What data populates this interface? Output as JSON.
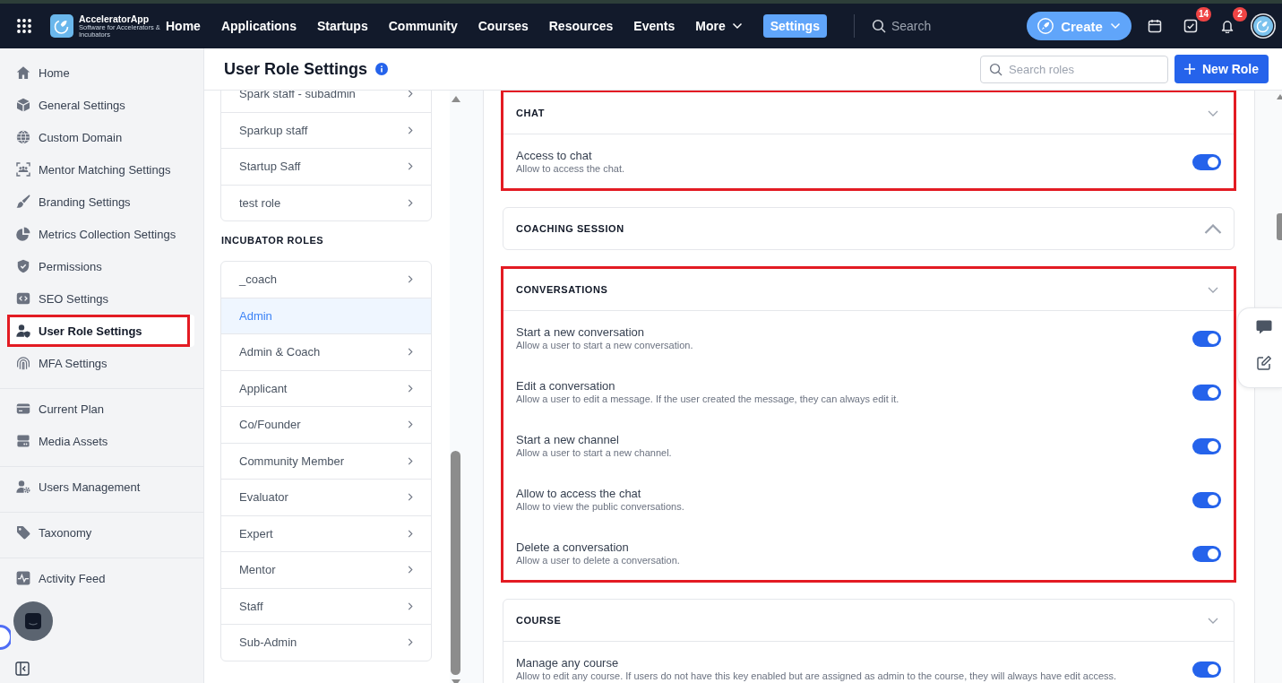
{
  "topbar": {
    "brand": "AcceleratorApp",
    "tagline": "Software for Accelerators & Incubators",
    "nav": [
      {
        "label": "Home",
        "kind": "link",
        "selected": false
      },
      {
        "label": "Applications",
        "kind": "link",
        "selected": false
      },
      {
        "label": "Startups",
        "kind": "link",
        "selected": false
      },
      {
        "label": "Community",
        "kind": "link",
        "selected": false
      },
      {
        "label": "Courses",
        "kind": "link",
        "selected": false
      },
      {
        "label": "Resources",
        "kind": "link",
        "selected": false
      },
      {
        "label": "Events",
        "kind": "link",
        "selected": false
      },
      {
        "label": "More",
        "kind": "menu",
        "selected": false
      },
      {
        "label": "Settings",
        "kind": "link",
        "selected": true
      }
    ],
    "search": {
      "placeholder": "Search"
    },
    "create_button": {
      "label": "Create"
    },
    "tasks_badge": "14",
    "notifications_badge": "2"
  },
  "sidebar": {
    "groups": [
      {
        "items": [
          {
            "label": "Home",
            "selected": false,
            "highlighted": false
          },
          {
            "label": "General Settings",
            "selected": false,
            "highlighted": false
          },
          {
            "label": "Custom Domain",
            "selected": false,
            "highlighted": false
          },
          {
            "label": "Mentor Matching Settings",
            "selected": false,
            "highlighted": false
          },
          {
            "label": "Branding Settings",
            "selected": false,
            "highlighted": false
          },
          {
            "label": "Metrics Collection Settings",
            "selected": false,
            "highlighted": false
          },
          {
            "label": "Permissions",
            "selected": false,
            "highlighted": false
          },
          {
            "label": "SEO Settings",
            "selected": false,
            "highlighted": false
          },
          {
            "label": "User Role Settings",
            "selected": true,
            "highlighted": true
          },
          {
            "label": "MFA Settings",
            "selected": false,
            "highlighted": false
          }
        ]
      },
      {
        "items": [
          {
            "label": "Current Plan",
            "selected": false,
            "highlighted": false
          },
          {
            "label": "Media Assets",
            "selected": false,
            "highlighted": false
          }
        ]
      },
      {
        "items": [
          {
            "label": "Users Management",
            "selected": false,
            "highlighted": false
          }
        ]
      },
      {
        "items": [
          {
            "label": "Taxonomy",
            "selected": false,
            "highlighted": false
          }
        ]
      },
      {
        "items": [
          {
            "label": "Activity Feed",
            "selected": false,
            "highlighted": false
          }
        ]
      }
    ]
  },
  "page": {
    "title": "User Role Settings",
    "search": {
      "placeholder": "Search roles"
    },
    "new_button": "New Role"
  },
  "role_groups": [
    {
      "roles": [
        {
          "label": "Spark staff - subadmin",
          "selected": false
        },
        {
          "label": "Sparkup staff",
          "selected": false
        },
        {
          "label": "Startup Saff",
          "selected": false
        },
        {
          "label": "test role",
          "selected": false
        }
      ]
    },
    {
      "heading": "INCUBATOR ROLES",
      "roles": [
        {
          "label": "_coach",
          "selected": false
        },
        {
          "label": "Admin",
          "selected": true
        },
        {
          "label": "Admin & Coach",
          "selected": false
        },
        {
          "label": "Applicant",
          "selected": false
        },
        {
          "label": "Co/Founder",
          "selected": false
        },
        {
          "label": "Community Member",
          "selected": false
        },
        {
          "label": "Evaluator",
          "selected": false
        },
        {
          "label": "Expert",
          "selected": false
        },
        {
          "label": "Mentor",
          "selected": false
        },
        {
          "label": "Staff",
          "selected": false
        },
        {
          "label": "Sub-Admin",
          "selected": false
        }
      ]
    }
  ],
  "sections": [
    {
      "title": "CHAT",
      "expanded": true,
      "highlighted": true,
      "permissions": [
        {
          "title": "Access to chat",
          "description": "Allow to access the chat.",
          "on": true
        }
      ]
    },
    {
      "title": "COACHING SESSION",
      "expanded": false,
      "highlighted": false
    },
    {
      "title": "CONVERSATIONS",
      "expanded": true,
      "highlighted": true,
      "permissions": [
        {
          "title": "Start a new conversation",
          "description": "Allow a user to start a new conversation.",
          "on": true
        },
        {
          "title": "Edit a conversation",
          "description": "Allow a user to edit a message. If the user created the message, they can always edit it.",
          "on": true
        },
        {
          "title": "Start a new channel",
          "description": "Allow a user to start a new channel.",
          "on": true
        },
        {
          "title": "Allow to access the chat",
          "description": "Allow to view the public conversations.",
          "on": true
        },
        {
          "title": "Delete a conversation",
          "description": "Allow a user to delete a conversation.",
          "on": true
        }
      ]
    },
    {
      "title": "COURSE",
      "expanded": true,
      "highlighted": false,
      "permissions": [
        {
          "title": "Manage any course",
          "description": "Allow to edit any course. If users do not have this key enabled but are assigned as admin to the course, they will always have edit access.",
          "on": true
        }
      ]
    }
  ]
}
